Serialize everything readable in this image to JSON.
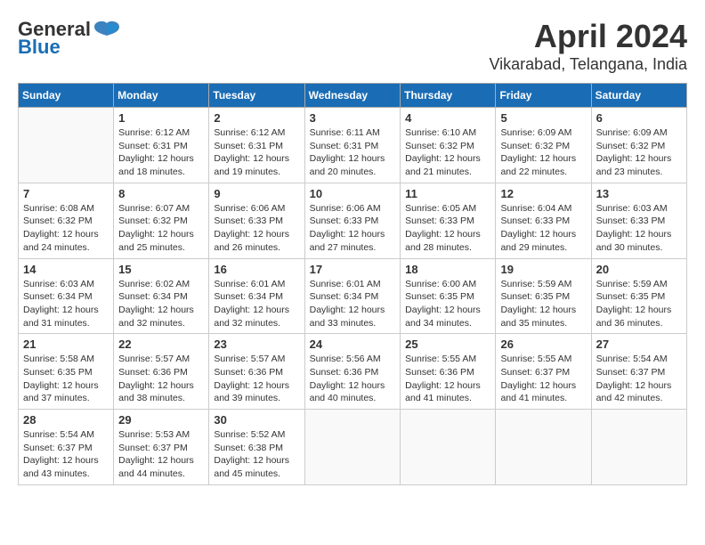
{
  "header": {
    "logo_general": "General",
    "logo_blue": "Blue",
    "month": "April 2024",
    "location": "Vikarabad, Telangana, India"
  },
  "weekdays": [
    "Sunday",
    "Monday",
    "Tuesday",
    "Wednesday",
    "Thursday",
    "Friday",
    "Saturday"
  ],
  "weeks": [
    [
      {
        "day": "",
        "info": ""
      },
      {
        "day": "1",
        "info": "Sunrise: 6:12 AM\nSunset: 6:31 PM\nDaylight: 12 hours\nand 18 minutes."
      },
      {
        "day": "2",
        "info": "Sunrise: 6:12 AM\nSunset: 6:31 PM\nDaylight: 12 hours\nand 19 minutes."
      },
      {
        "day": "3",
        "info": "Sunrise: 6:11 AM\nSunset: 6:31 PM\nDaylight: 12 hours\nand 20 minutes."
      },
      {
        "day": "4",
        "info": "Sunrise: 6:10 AM\nSunset: 6:32 PM\nDaylight: 12 hours\nand 21 minutes."
      },
      {
        "day": "5",
        "info": "Sunrise: 6:09 AM\nSunset: 6:32 PM\nDaylight: 12 hours\nand 22 minutes."
      },
      {
        "day": "6",
        "info": "Sunrise: 6:09 AM\nSunset: 6:32 PM\nDaylight: 12 hours\nand 23 minutes."
      }
    ],
    [
      {
        "day": "7",
        "info": "Sunrise: 6:08 AM\nSunset: 6:32 PM\nDaylight: 12 hours\nand 24 minutes."
      },
      {
        "day": "8",
        "info": "Sunrise: 6:07 AM\nSunset: 6:32 PM\nDaylight: 12 hours\nand 25 minutes."
      },
      {
        "day": "9",
        "info": "Sunrise: 6:06 AM\nSunset: 6:33 PM\nDaylight: 12 hours\nand 26 minutes."
      },
      {
        "day": "10",
        "info": "Sunrise: 6:06 AM\nSunset: 6:33 PM\nDaylight: 12 hours\nand 27 minutes."
      },
      {
        "day": "11",
        "info": "Sunrise: 6:05 AM\nSunset: 6:33 PM\nDaylight: 12 hours\nand 28 minutes."
      },
      {
        "day": "12",
        "info": "Sunrise: 6:04 AM\nSunset: 6:33 PM\nDaylight: 12 hours\nand 29 minutes."
      },
      {
        "day": "13",
        "info": "Sunrise: 6:03 AM\nSunset: 6:33 PM\nDaylight: 12 hours\nand 30 minutes."
      }
    ],
    [
      {
        "day": "14",
        "info": "Sunrise: 6:03 AM\nSunset: 6:34 PM\nDaylight: 12 hours\nand 31 minutes."
      },
      {
        "day": "15",
        "info": "Sunrise: 6:02 AM\nSunset: 6:34 PM\nDaylight: 12 hours\nand 32 minutes."
      },
      {
        "day": "16",
        "info": "Sunrise: 6:01 AM\nSunset: 6:34 PM\nDaylight: 12 hours\nand 32 minutes."
      },
      {
        "day": "17",
        "info": "Sunrise: 6:01 AM\nSunset: 6:34 PM\nDaylight: 12 hours\nand 33 minutes."
      },
      {
        "day": "18",
        "info": "Sunrise: 6:00 AM\nSunset: 6:35 PM\nDaylight: 12 hours\nand 34 minutes."
      },
      {
        "day": "19",
        "info": "Sunrise: 5:59 AM\nSunset: 6:35 PM\nDaylight: 12 hours\nand 35 minutes."
      },
      {
        "day": "20",
        "info": "Sunrise: 5:59 AM\nSunset: 6:35 PM\nDaylight: 12 hours\nand 36 minutes."
      }
    ],
    [
      {
        "day": "21",
        "info": "Sunrise: 5:58 AM\nSunset: 6:35 PM\nDaylight: 12 hours\nand 37 minutes."
      },
      {
        "day": "22",
        "info": "Sunrise: 5:57 AM\nSunset: 6:36 PM\nDaylight: 12 hours\nand 38 minutes."
      },
      {
        "day": "23",
        "info": "Sunrise: 5:57 AM\nSunset: 6:36 PM\nDaylight: 12 hours\nand 39 minutes."
      },
      {
        "day": "24",
        "info": "Sunrise: 5:56 AM\nSunset: 6:36 PM\nDaylight: 12 hours\nand 40 minutes."
      },
      {
        "day": "25",
        "info": "Sunrise: 5:55 AM\nSunset: 6:36 PM\nDaylight: 12 hours\nand 41 minutes."
      },
      {
        "day": "26",
        "info": "Sunrise: 5:55 AM\nSunset: 6:37 PM\nDaylight: 12 hours\nand 41 minutes."
      },
      {
        "day": "27",
        "info": "Sunrise: 5:54 AM\nSunset: 6:37 PM\nDaylight: 12 hours\nand 42 minutes."
      }
    ],
    [
      {
        "day": "28",
        "info": "Sunrise: 5:54 AM\nSunset: 6:37 PM\nDaylight: 12 hours\nand 43 minutes."
      },
      {
        "day": "29",
        "info": "Sunrise: 5:53 AM\nSunset: 6:37 PM\nDaylight: 12 hours\nand 44 minutes."
      },
      {
        "day": "30",
        "info": "Sunrise: 5:52 AM\nSunset: 6:38 PM\nDaylight: 12 hours\nand 45 minutes."
      },
      {
        "day": "",
        "info": ""
      },
      {
        "day": "",
        "info": ""
      },
      {
        "day": "",
        "info": ""
      },
      {
        "day": "",
        "info": ""
      }
    ]
  ]
}
